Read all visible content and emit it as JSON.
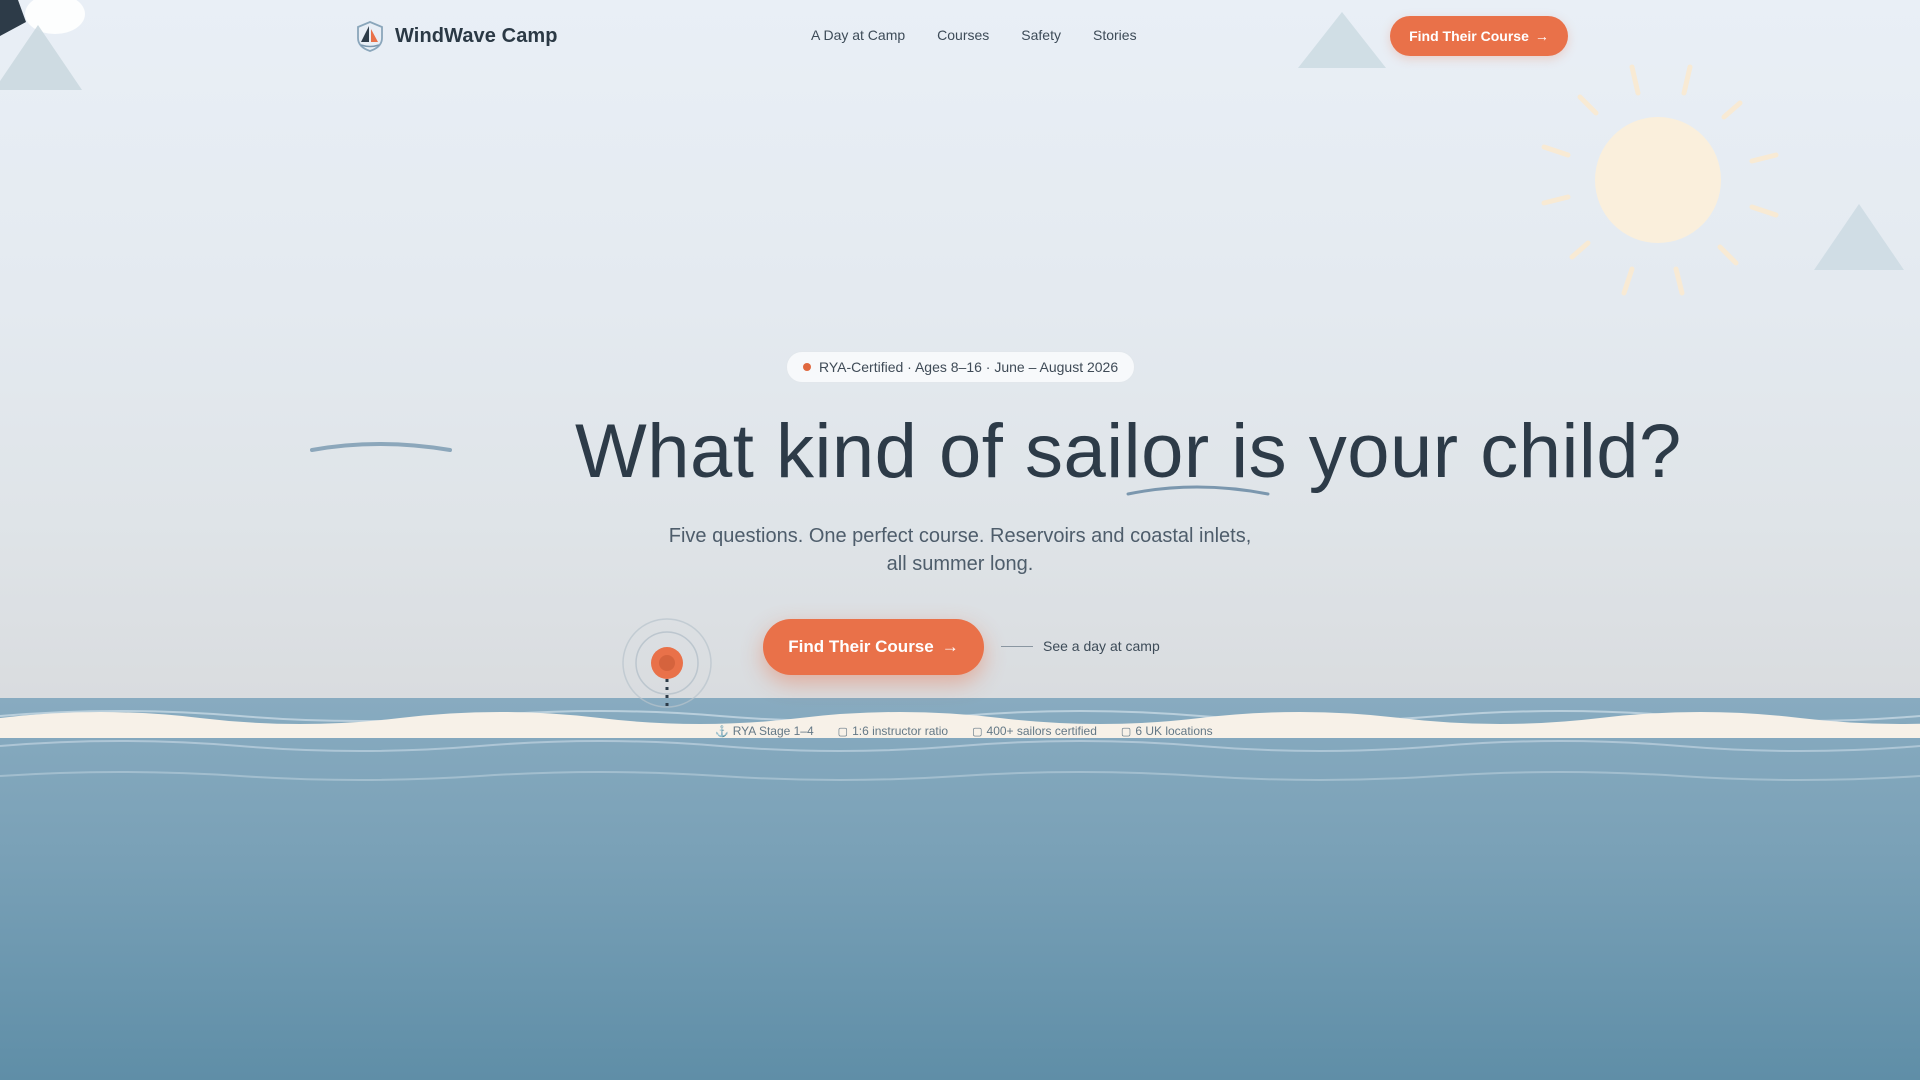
{
  "brand": {
    "name": "WindWave Camp",
    "logo_icon": "sailboat-shield-icon"
  },
  "nav": {
    "links": [
      "A Day at Camp",
      "Courses",
      "Safety",
      "Stories"
    ]
  },
  "header": {
    "cta_label": "Find Their Course",
    "cta_arrow": "→"
  },
  "hero": {
    "badge": "RYA-Certified · Ages 8–16 · June – August 2026",
    "headline": "What kind of sailor is your child?",
    "subheadline": "Five questions. One perfect course. Reservoirs and coastal inlets, all summer long.",
    "cta_label": "Find Their Course",
    "cta_arrow": "→",
    "secondary_link": "See a day at camp"
  },
  "stats": [
    {
      "icon": "⚓",
      "icon_name": "anchor-icon",
      "label": "RYA Stage 1–4"
    },
    {
      "icon": "▢",
      "icon_name": "ratio-icon",
      "label": "1:6 instructor ratio"
    },
    {
      "icon": "▢",
      "icon_name": "certificate-icon",
      "label": "400+ sailors certified"
    },
    {
      "icon": "▢",
      "icon_name": "location-icon",
      "label": "6 UK locations"
    }
  ],
  "colors": {
    "accent": "#e97149",
    "text_dark": "#2d3b48",
    "sea": "#6a96ae",
    "sand": "#f7f1e8",
    "sun": "#faefdc"
  }
}
